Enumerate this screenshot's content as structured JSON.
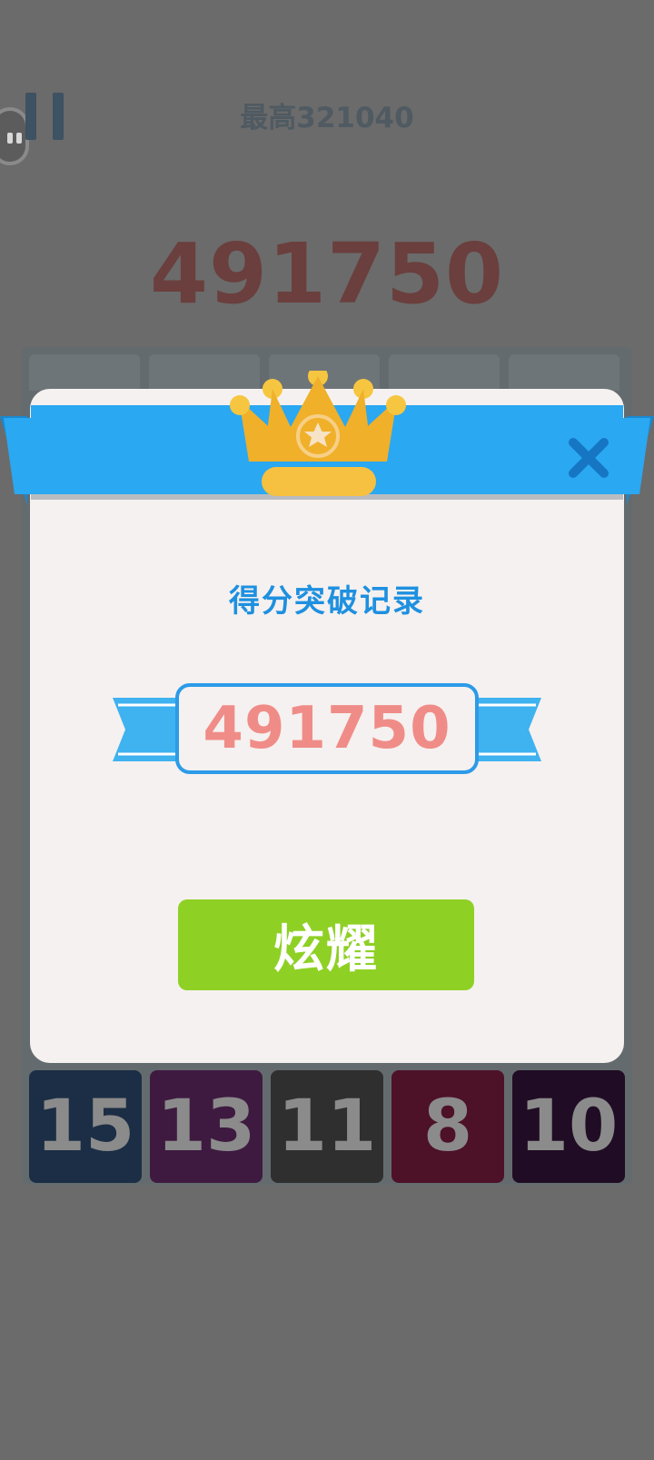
{
  "header": {
    "best_score_text": "最高321040",
    "current_score": "491750"
  },
  "board": {
    "bottom_row_tiles": [
      {
        "value": "15",
        "color": "#1c2e45"
      },
      {
        "value": "13",
        "color": "#3e1a40"
      },
      {
        "value": "11",
        "color": "#2f2f2f"
      },
      {
        "value": "8",
        "color": "#4d1128"
      },
      {
        "value": "10",
        "color": "#200c24"
      }
    ]
  },
  "modal": {
    "title": "得分突破记录",
    "record_score": "491750",
    "share_button_label": "炫耀",
    "close_icon": "close-x-icon",
    "crown_icon": "crown-icon"
  },
  "colors": {
    "overlay_bg": "#6b6b6b",
    "ribbon_blue": "#2aa8f2",
    "title_blue": "#1e90e0",
    "record_red": "#f08c87",
    "button_green": "#8fd025",
    "crown_gold": "#f0b02a"
  }
}
